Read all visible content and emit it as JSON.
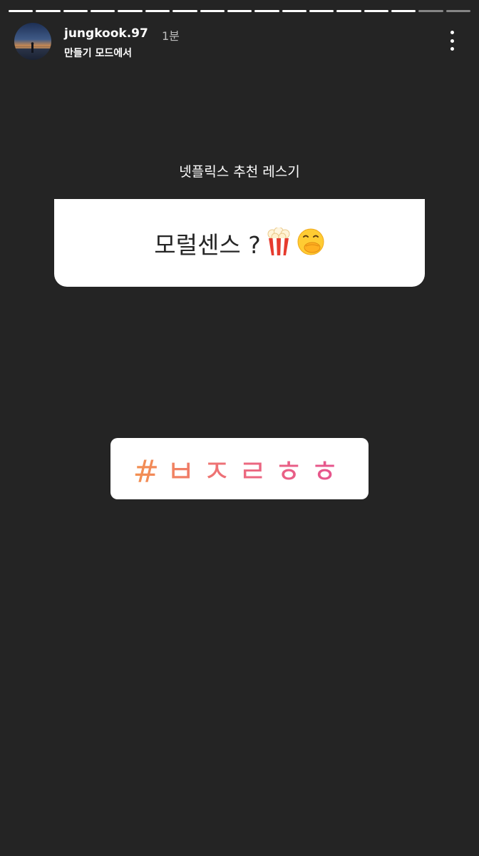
{
  "story": {
    "segments_total": 17,
    "segments_viewed": 15
  },
  "header": {
    "username": "jungkook.97",
    "time": "1분",
    "subtitle": "만들기 모드에서",
    "more_icon": "more-vertical-icon"
  },
  "question_sticker": {
    "label": "넷플릭스 추천 레스기",
    "answer": "모럴센스 ?",
    "emojis": [
      "popcorn-icon",
      "face-with-hand-over-mouth-icon"
    ]
  },
  "hashtag_sticker": {
    "text": "#ㅂㅈㄹㅎㅎ",
    "colors": [
      "#f39150",
      "#ec6a7e",
      "#e5528f"
    ]
  },
  "colors": {
    "background": "#242424",
    "card": "#ffffff",
    "text_dark": "#262626"
  }
}
